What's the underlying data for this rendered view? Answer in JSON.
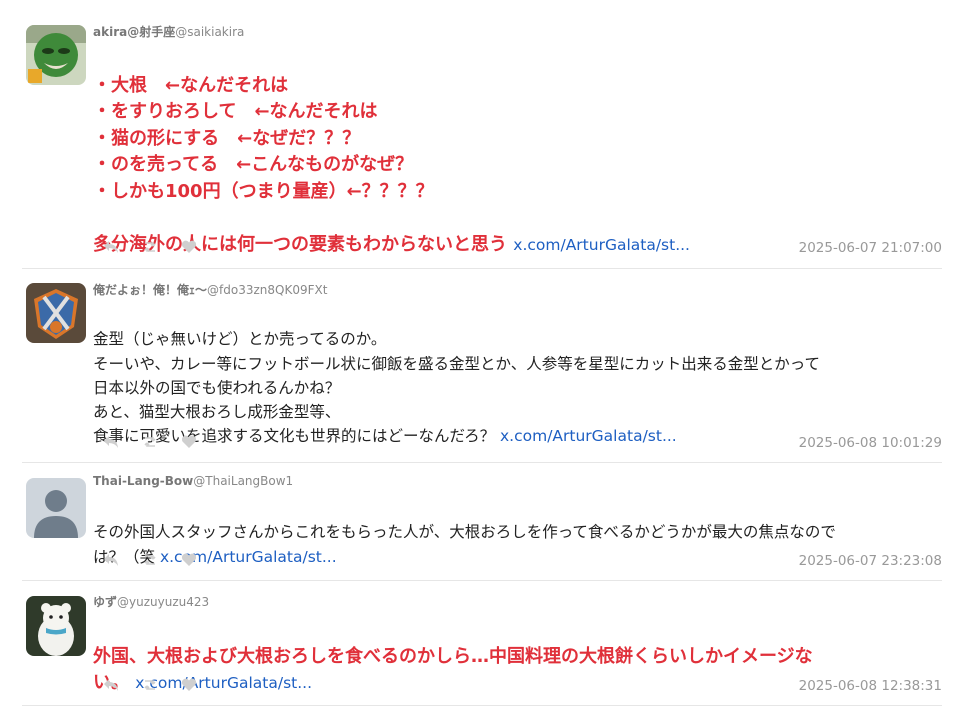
{
  "tweets": [
    {
      "display_name": "akira@射手座",
      "handle": "@saikiakira",
      "style": "red",
      "text": "・大根　←なんだそれは\n・をすりおろして　←なんだそれは\n・猫の形にする　←なぜだ？？？\n・のを売ってる　←こんなものがなぜ？\n・しかも100円（つまり量産）←？？？？\n\n多分海外の人には何一つの要素もわからないと思う ",
      "link": "x.com/ArturGalata/st...",
      "timestamp": "2025-06-07 21:07:00"
    },
    {
      "display_name": "俺だよぉ！俺！俺ｪ～",
      "handle": "@fdo33zn8QK09FXt",
      "style": "normal",
      "text": "金型（じゃ無いけど）とか売ってるのか。\nそーいや、カレー等にフットボール状に御飯を盛る金型とか、人参等を星型にカット出来る金型とかって\n日本以外の国でも使われるんかね？\nあと、猫型大根おろし成形金型等、\n食事に可愛いを追求する文化も世界的にはどーなんだろ？ ",
      "link": "x.com/ArturGalata/st...",
      "timestamp": "2025-06-08 10:01:29"
    },
    {
      "display_name": "Thai-Lang-Bow",
      "handle": "@ThaiLangBow1",
      "style": "normal",
      "text": "その外国人スタッフさんからこれをもらった人が、大根おろしを作って食べるかどうかが最大の焦点なので\nは？（笑 ",
      "link": "x.com/ArturGalata/st...",
      "timestamp": "2025-06-07 23:23:08"
    },
    {
      "display_name": "ゆず",
      "handle": "@yuzuyuzu423",
      "style": "red",
      "text": "外国、大根および大根おろしを食べるのかしら…中国料理の大根餅くらいしかイメージな\nい。 ",
      "link": "x.com/ArturGalata/st...",
      "timestamp": "2025-06-08 12:38:31"
    }
  ],
  "icons": {
    "reply": "reply-icon",
    "retweet": "retweet-icon",
    "like": "heart-icon"
  },
  "colors": {
    "highlight_text": "#e0303a",
    "link": "#1e5fc2",
    "meta": "#999999"
  }
}
